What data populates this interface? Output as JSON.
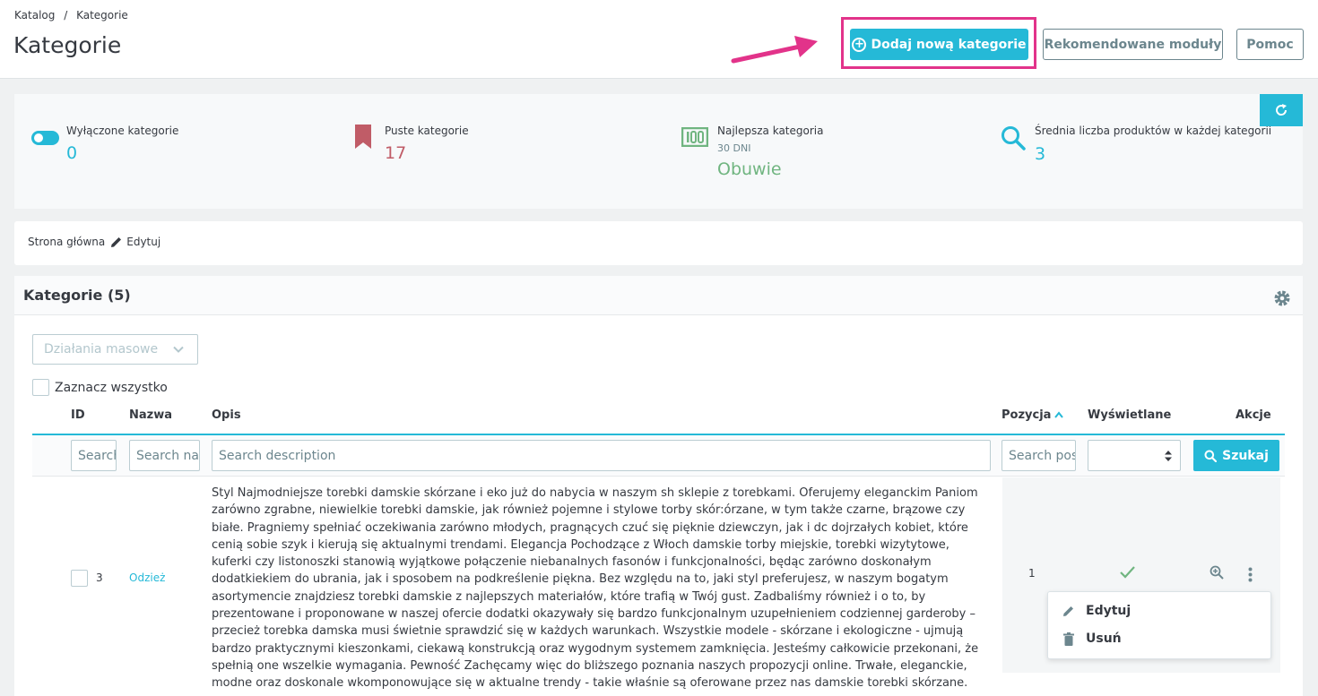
{
  "breadcrumb": {
    "parent": "Katalog",
    "separator": "/",
    "current": "Kategorie"
  },
  "page": {
    "title": "Kategorie"
  },
  "toolbar": {
    "add_label": "Dodaj nową kategorie",
    "modules_label": "Rekomendowane moduły",
    "help_label": "Pomoc"
  },
  "kpi": [
    {
      "label": "Wyłączone kategorie",
      "sub": "",
      "value": "0",
      "icon": "toggle-icon",
      "color": "#25b9d7"
    },
    {
      "label": "Puste kategorie",
      "sub": "",
      "value": "17",
      "icon": "bookmark-icon",
      "color": "#c05c67"
    },
    {
      "label": "Najlepsza kategoria",
      "sub": "30 DNI",
      "value": "Obuwie",
      "icon": "money-icon",
      "color": "#70b580"
    },
    {
      "label": "Średnia liczba produktów w każdej kategorii",
      "sub": "",
      "value": "3",
      "icon": "search-icon",
      "color": "#25b9d7"
    }
  ],
  "category_breadcrumb": {
    "home": "Strona główna",
    "edit_label": "Edytuj"
  },
  "list": {
    "title": "Kategorie (5)",
    "bulk_label": "Działania masowe",
    "select_all_label": "Zaznacz wszystko",
    "columns": {
      "id": "ID",
      "name": "Nazwa",
      "description": "Opis",
      "position": "Pozycja",
      "displayed": "Wyświetlane",
      "actions": "Akcje"
    },
    "filters": {
      "id_placeholder": "Search ID",
      "name_placeholder": "Search name",
      "description_placeholder": "Search description",
      "position_placeholder": "Search position",
      "search_label": "Szukaj"
    },
    "rows": [
      {
        "id": "3",
        "name": "Odzież",
        "description": "Styl Najmodniejsze torebki damskie skórzane i eko już do nabycia w naszym sh sklepie z torebkami. Oferujemy eleganckim Paniom zarówno zgrabne, niewielkie torebki damskie, jak również pojemne i stylowe torby skór:órzane, w tym także czarne, brązowe czy białe. Pragniemy spełniać oczekiwania zarówno młodych, pragnących czuć się pięknie dziewczyn, jak i dc dojrzałych kobiet, które cenią sobie szyk i kierują się aktualnymi trendami. Elegancja Pochodzące z Włoch damskie torby miejskie, torebki wizytytowe, kuferki czy listonoszki stanowią wyjątkowe połączenie niebanalnych fasonów i funkcjonalności, będąc zarówno doskonałym dodatkiekiem do ubrania, jak i sposobem na podkreślenie piękna. Bez względu na to, jaki styl preferujesz, w naszym bogatym asortymencie znajdziesz torebki damskie z najlepszych materiałów, które trafią w Twój gust. Zadbaliśmy również i o to, by prezentowane i proponowane w naszej ofercie dodatki okazywały się bardzo funkcjonalnym uzupełnieniem codziennej garderoby – przecież torebka damska musi świetnie sprawdzić się w każdych warunkach. Wszystkie modele - skórzane i ekologiczne - ujmują bardzo praktycznymi kieszonkami, ciekawą konstrukcją oraz wygodnym systemem zamknięcia. Jesteśmy całkowicie przekonani, że spełnią one wszelkie wymagania. Pewność Zachęcamy więc do bliższego poznania naszych propozycji online. Trwałe, eleganckie, modne oraz doskonale wkomponowujące się w aktualne trendy - takie właśnie są oferowane przez nas damskie torebki skórzane.",
        "position": "1"
      }
    ],
    "dropdown": {
      "edit_label": "Edytuj",
      "delete_label": "Usuń"
    }
  },
  "colors": {
    "accent": "#25b9d7",
    "highlight": "#e2338a",
    "success": "#70b580",
    "danger": "#c05c67"
  }
}
